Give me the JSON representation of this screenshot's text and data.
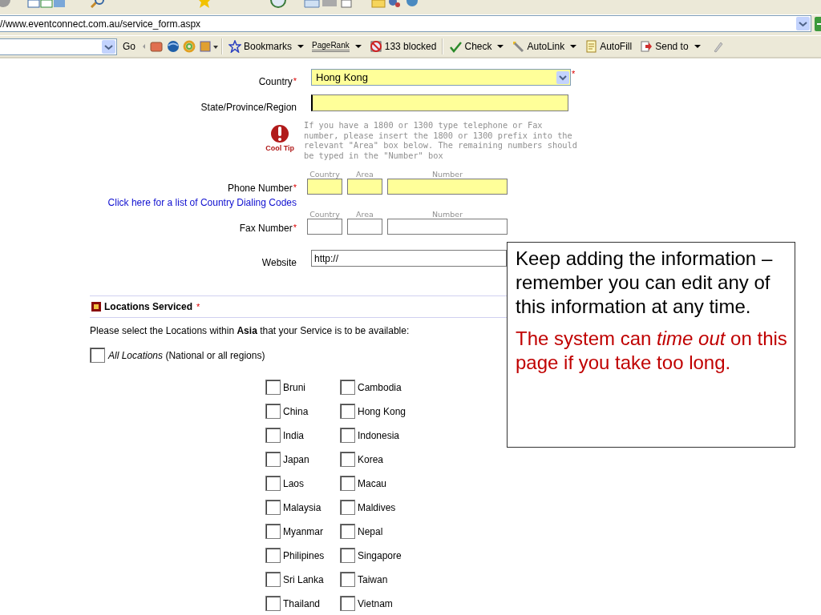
{
  "address_bar": {
    "url": "//www.eventconnect.com.au/service_form.aspx"
  },
  "toolbar": [
    {
      "kind": "go",
      "label": "Go"
    },
    {
      "kind": "bookmarks",
      "label": "Bookmarks"
    },
    {
      "kind": "pagerank",
      "label": "PageRank"
    },
    {
      "kind": "blocked",
      "label": "133 blocked"
    },
    {
      "kind": "check",
      "label": "Check"
    },
    {
      "kind": "autolink",
      "label": "AutoLink"
    },
    {
      "kind": "autofill",
      "label": "AutoFill"
    },
    {
      "kind": "sendto",
      "label": "Send to"
    }
  ],
  "form": [
    {
      "kind": "select",
      "label": "Country",
      "value": "Hong Kong",
      "highlighted": true,
      "mark": "*"
    },
    {
      "kind": "text",
      "label": "State/Province/Region",
      "highlighted": true,
      "focused": true
    },
    {
      "kind": "tip",
      "badge": "Cool Tip",
      "text": "If you have a 1800 or 1300 type telephone or Fax number, please insert the 1800 or 1300 prefix into the relevant \"Area\" box below. The remaining numbers should be typed in the \"Number\" box"
    },
    {
      "kind": "phone",
      "label": "Phone Number",
      "mark": "*",
      "link": "Click here for a list of Country Dialing Codes",
      "parts": [
        "Country",
        "Area",
        "Number"
      ],
      "highlighted": true
    },
    {
      "kind": "phone",
      "label": "Fax Number",
      "mark": "*",
      "parts": [
        "Country",
        "Area",
        "Number"
      ],
      "highlighted": false
    },
    {
      "kind": "text",
      "label": "Website",
      "value": "http://",
      "highlighted": false,
      "focused": false
    }
  ],
  "locations": {
    "title": "Locations Serviced",
    "mark": "*",
    "instruction": "Please select the Locations within **Asia** that your Service is to be available:",
    "all": {
      "label": "All Locations",
      "note": "(National or all regions)",
      "checked": false
    },
    "items": [
      {
        "label": "Bruni",
        "checked": false
      },
      {
        "label": "Cambodia",
        "checked": false
      },
      {
        "label": "China",
        "checked": false
      },
      {
        "label": "Hong Kong",
        "checked": false
      },
      {
        "label": "India",
        "checked": false
      },
      {
        "label": "Indonesia",
        "checked": false
      },
      {
        "label": "Japan",
        "checked": false
      },
      {
        "label": "Korea",
        "checked": false
      },
      {
        "label": "Laos",
        "checked": false
      },
      {
        "label": "Macau",
        "checked": false
      },
      {
        "label": "Malaysia",
        "checked": false
      },
      {
        "label": "Maldives",
        "checked": false
      },
      {
        "label": "Myanmar",
        "checked": false
      },
      {
        "label": "Nepal",
        "checked": false
      },
      {
        "label": "Philipines",
        "checked": false
      },
      {
        "label": "Singapore",
        "checked": false
      },
      {
        "label": "Sri Lanka",
        "checked": false
      },
      {
        "label": "Taiwan",
        "checked": false
      },
      {
        "label": "Thailand",
        "checked": false
      },
      {
        "label": "Vietnam",
        "checked": false
      }
    ]
  },
  "callout": {
    "paragraphs": [
      {
        "text": "Keep adding the information – remember you can edit any of this information at any time.",
        "color": "#000000"
      },
      {
        "text": "The system can *time out* on this page if you take too long.",
        "color": "#c00000"
      }
    ]
  }
}
